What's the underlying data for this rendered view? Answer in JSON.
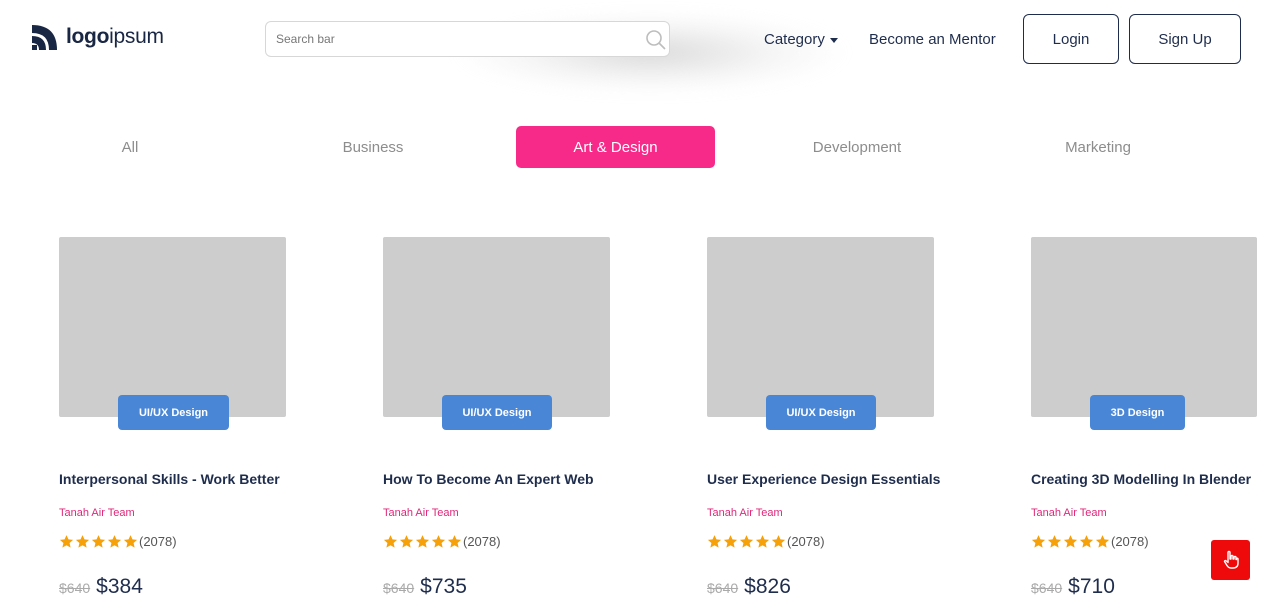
{
  "header": {
    "logo": {
      "bold": "logo",
      "light": "ipsum"
    },
    "search": {
      "placeholder": "Search bar"
    },
    "nav": {
      "category_label": "Category",
      "mentor_label": "Become an Mentor"
    },
    "buttons": {
      "login": "Login",
      "signup": "Sign Up"
    }
  },
  "tabs": [
    {
      "label": "All",
      "active": false
    },
    {
      "label": "Business",
      "active": false
    },
    {
      "label": "Art & Design",
      "active": true
    },
    {
      "label": "Development",
      "active": false
    },
    {
      "label": "Marketing",
      "active": false
    }
  ],
  "courses": [
    {
      "tag": "UI/UX Design",
      "title": "Interpersonal Skills - Work Better",
      "author": "Tanah Air Team",
      "rating": 5,
      "reviews": "(2078)",
      "old_price": "$640",
      "price": "$384"
    },
    {
      "tag": "UI/UX Design",
      "title": "How To Become An Expert Web",
      "author": "Tanah Air Team",
      "rating": 5,
      "reviews": "(2078)",
      "old_price": "$640",
      "price": "$735"
    },
    {
      "tag": "UI/UX Design",
      "title": "User Experience Design Essentials",
      "author": "Tanah Air Team",
      "rating": 5,
      "reviews": "(2078)",
      "old_price": "$640",
      "price": "$826"
    },
    {
      "tag": "3D Design",
      "title": "Creating 3D Modelling In Blender",
      "author": "Tanah Air Team",
      "rating": 5,
      "reviews": "(2078)",
      "old_price": "$640",
      "price": "$710"
    }
  ],
  "colors": {
    "accent": "#f72a8a",
    "tag_blue": "#4a86d6",
    "star": "#f6a00a",
    "navy": "#1f2d4d",
    "fab_red": "#ee0a0a"
  },
  "icons": {
    "logo": "logo-mark-icon",
    "search": "search-icon",
    "caret": "chevron-down-icon",
    "star": "star-icon",
    "fab": "hand-pointer-icon"
  }
}
